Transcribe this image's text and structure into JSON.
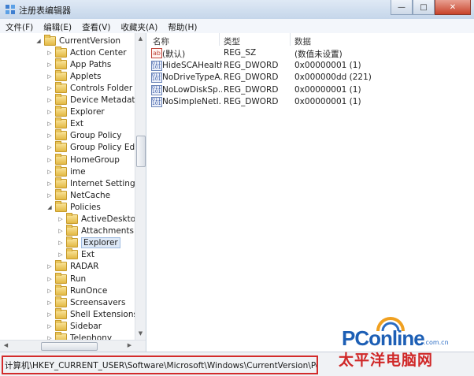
{
  "window": {
    "title": "注册表编辑器"
  },
  "menu": [
    "文件(F)",
    "编辑(E)",
    "查看(V)",
    "收藏夹(A)",
    "帮助(H)"
  ],
  "tree": [
    {
      "label": "CurrentVersion",
      "expanded": true,
      "level": 0
    },
    {
      "label": "Action Center",
      "level": 1
    },
    {
      "label": "App Paths",
      "level": 1
    },
    {
      "label": "Applets",
      "level": 1
    },
    {
      "label": "Controls Folder",
      "level": 1
    },
    {
      "label": "Device Metadata",
      "level": 1
    },
    {
      "label": "Explorer",
      "level": 1
    },
    {
      "label": "Ext",
      "level": 1
    },
    {
      "label": "Group Policy",
      "level": 1
    },
    {
      "label": "Group Policy Editor",
      "level": 1
    },
    {
      "label": "HomeGroup",
      "level": 1
    },
    {
      "label": "ime",
      "level": 1
    },
    {
      "label": "Internet Settings",
      "level": 1
    },
    {
      "label": "NetCache",
      "level": 1
    },
    {
      "label": "Policies",
      "expanded": true,
      "level": 1
    },
    {
      "label": "ActiveDesktop",
      "level": 2
    },
    {
      "label": "Attachments",
      "level": 2
    },
    {
      "label": "Explorer",
      "level": 2,
      "selected": true
    },
    {
      "label": "Ext",
      "level": 2
    },
    {
      "label": "RADAR",
      "level": 1
    },
    {
      "label": "Run",
      "level": 1
    },
    {
      "label": "RunOnce",
      "level": 1
    },
    {
      "label": "Screensavers",
      "level": 1
    },
    {
      "label": "Shell Extensions",
      "level": 1
    },
    {
      "label": "Sidebar",
      "level": 1
    },
    {
      "label": "Telephony",
      "level": 1
    }
  ],
  "list": {
    "columns": [
      "名称",
      "类型",
      "数据"
    ],
    "rows": [
      {
        "icon": "string-value-icon",
        "name": "(默认)",
        "type": "REG_SZ",
        "data": "(数值未设置)"
      },
      {
        "icon": "binary-value-icon",
        "name": "HideSCAHealth",
        "type": "REG_DWORD",
        "data": "0x00000001 (1)"
      },
      {
        "icon": "binary-value-icon",
        "name": "NoDriveTypeA...",
        "type": "REG_DWORD",
        "data": "0x000000dd (221)"
      },
      {
        "icon": "binary-value-icon",
        "name": "NoLowDiskSp...",
        "type": "REG_DWORD",
        "data": "0x00000001 (1)"
      },
      {
        "icon": "binary-value-icon",
        "name": "NoSimpleNetI...",
        "type": "REG_DWORD",
        "data": "0x00000001 (1)"
      }
    ]
  },
  "status": {
    "path": "计算机\\HKEY_CURRENT_USER\\Software\\Microsoft\\Windows\\CurrentVersion\\Policies\\Explorer"
  },
  "watermark": {
    "brand": "PConline",
    "domain": ".com.cn",
    "cn": "太平洋电脑网"
  },
  "colors": {
    "highlight": "#d32b2b",
    "selection": "#dde8f6",
    "brand_blue": "#1d5fb5",
    "brand_red": "#d02828"
  }
}
